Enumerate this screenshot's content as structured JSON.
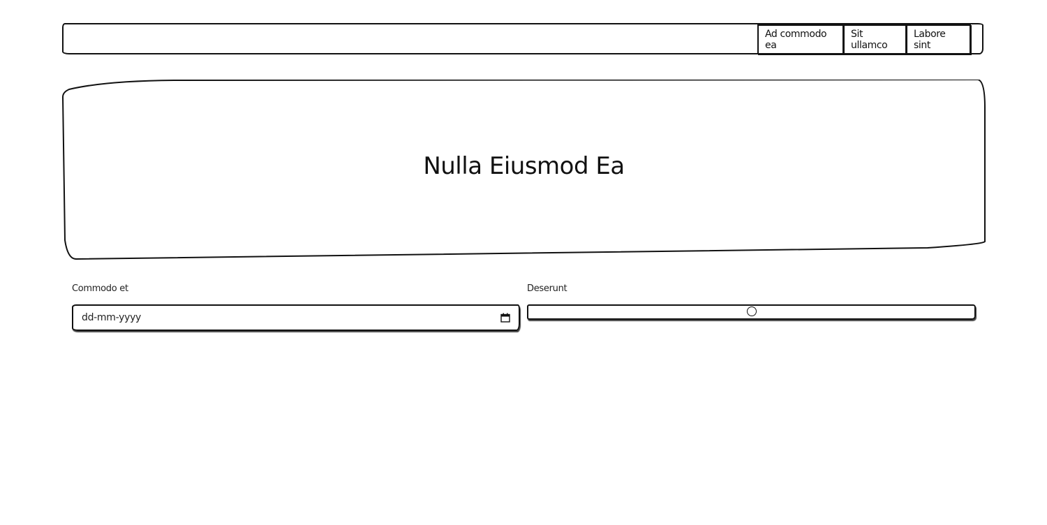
{
  "nav": {
    "items": [
      {
        "label": "Ad commodo ea"
      },
      {
        "label": "Sit ullamco"
      },
      {
        "label": "Labore sint"
      }
    ]
  },
  "hero": {
    "title": "Nulla Eiusmod Ea"
  },
  "form": {
    "date_field": {
      "label": "Commodo et",
      "placeholder": "dd-mm-yyyy",
      "icon": "calendar-icon"
    },
    "range_field": {
      "label": "Deserunt",
      "value": 50,
      "min": 0,
      "max": 100
    }
  }
}
